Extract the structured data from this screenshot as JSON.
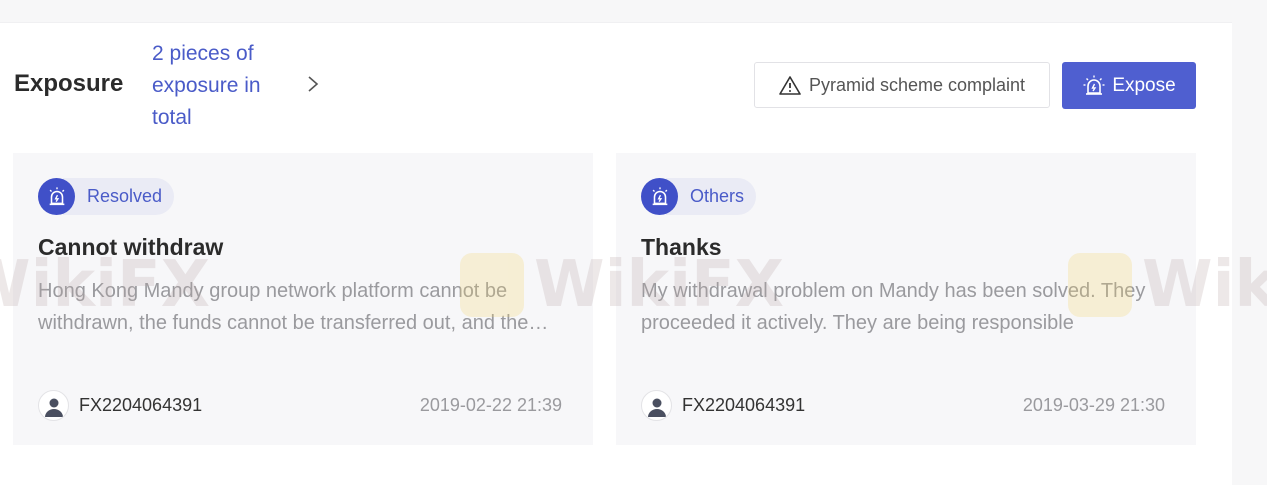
{
  "header": {
    "title": "Exposure",
    "count_text": "2 pieces of exposure in total",
    "complaint_button": "Pyramid scheme complaint",
    "expose_button": "Expose"
  },
  "colors": {
    "accent": "#4f5fd0",
    "link": "#4a5bc8",
    "card_bg": "#f7f7f9",
    "tag_bg": "#eaebf5"
  },
  "icons": {
    "complaint": "warning-triangle-icon",
    "expose": "siren-icon",
    "tag": "siren-icon",
    "chevron": "chevron-right-icon",
    "avatar": "user-avatar-icon"
  },
  "watermark": {
    "text": "WikiFX"
  },
  "cards": [
    {
      "tag": "Resolved",
      "title": "Cannot withdraw",
      "description": "Hong Kong Mandy group network platform cannot be withdrawn, the funds cannot be transferred out, and the website cannot be opened",
      "user": "FX2204064391",
      "date": "2019-02-22 21:39"
    },
    {
      "tag": "Others",
      "title": "Thanks",
      "description": "My withdrawal problem on Mandy has been solved. They proceeded it actively. They are being responsible",
      "user": "FX2204064391",
      "date": "2019-03-29 21:30"
    }
  ]
}
